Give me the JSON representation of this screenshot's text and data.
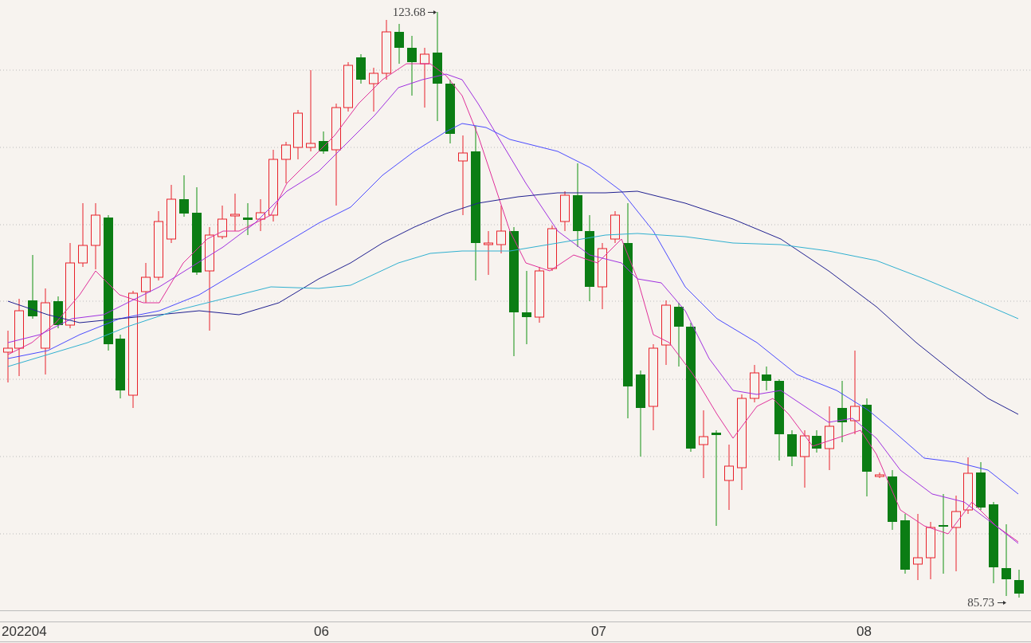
{
  "chart": {
    "max_label": "123.68",
    "min_label": "85.73"
  },
  "time_axis": {
    "labels": [
      "202204",
      "06",
      "07",
      "08"
    ]
  }
}
